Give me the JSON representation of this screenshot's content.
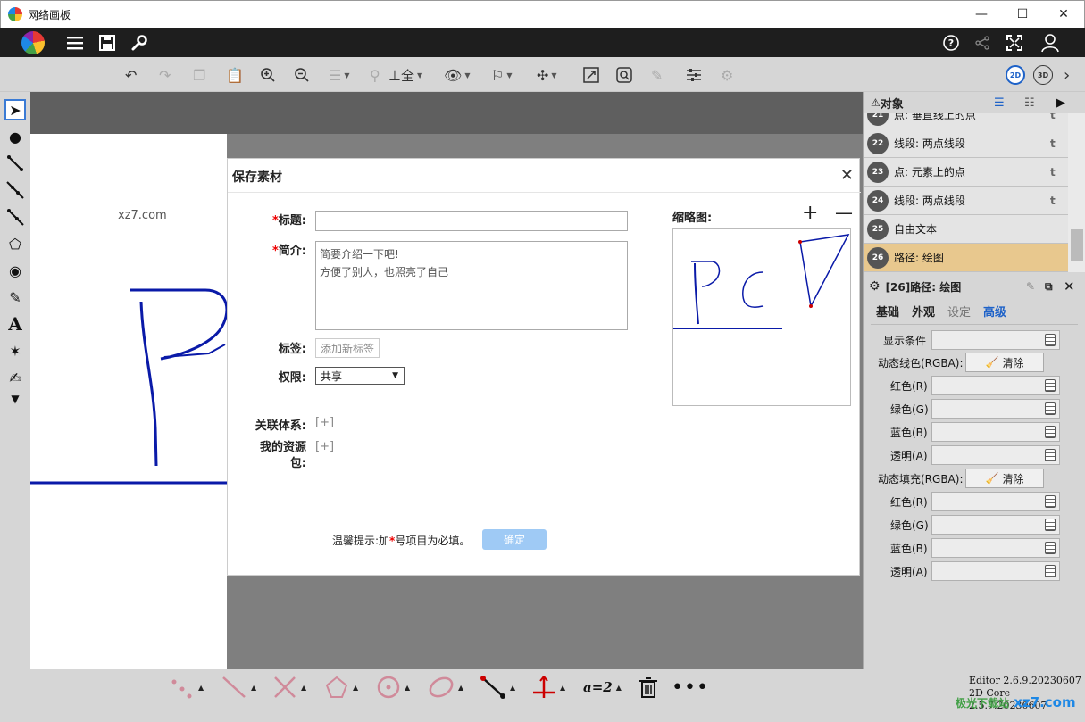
{
  "window": {
    "title": "网络画板",
    "minimize": "—",
    "maximize": "☐",
    "close": "✕"
  },
  "canvas": {
    "watermark": "xz7.com"
  },
  "objects_panel": {
    "title": "对象",
    "items": [
      {
        "num": "21",
        "label": "点: 垂直线上的点"
      },
      {
        "num": "22",
        "label": "线段: 两点线段"
      },
      {
        "num": "23",
        "label": "点: 元素上的点"
      },
      {
        "num": "24",
        "label": "线段: 两点线段"
      },
      {
        "num": "25",
        "label": "自由文本"
      },
      {
        "num": "26",
        "label": "路径: 绘图"
      }
    ]
  },
  "properties_panel": {
    "title": "[26]路径: 绘图",
    "tabs": [
      "基础",
      "外观",
      "设定",
      "高级"
    ],
    "display_condition": "显示条件",
    "dynamic_line": "动态线色(RGBA):",
    "dynamic_fill": "动态填充(RGBA):",
    "clear_label": "清除",
    "red": "红色(R)",
    "green": "绿色(G)",
    "blue": "蓝色(B)",
    "alpha": "透明(A)"
  },
  "dialog": {
    "title": "保存素材",
    "title_label": "标题:",
    "intro_label": "简介:",
    "intro_value": "简要介绍一下吧!\n方便了别人，也照亮了自己",
    "tags_label": "标签:",
    "tags_placeholder": "添加新标签",
    "permission_label": "权限:",
    "permission_value": "共享",
    "related_label": "关联体系:",
    "resource_label": "我的资源\n包:",
    "plus": "[+]",
    "thumbnail_label": "缩略图:",
    "hint_prefix": "温馨提示:加",
    "hint_suffix": "号项目为必填。",
    "asterisk": "*",
    "confirm": "确定"
  },
  "footer": {
    "version_editor": "Editor 2.6.9.20230607",
    "version_core": "2D Core 2.5.7.20230607",
    "brand": "xz7.com",
    "brand_small": "极光下载站",
    "assign_label": "a=2"
  },
  "modes": {
    "two_d": "2D",
    "three_d": "3D"
  },
  "colors": {
    "accent": "#1e62c8",
    "selected_row": "#e8c88e",
    "confirm_btn": "#9fcaf5",
    "stroke_blue": "#0a1aa8"
  }
}
